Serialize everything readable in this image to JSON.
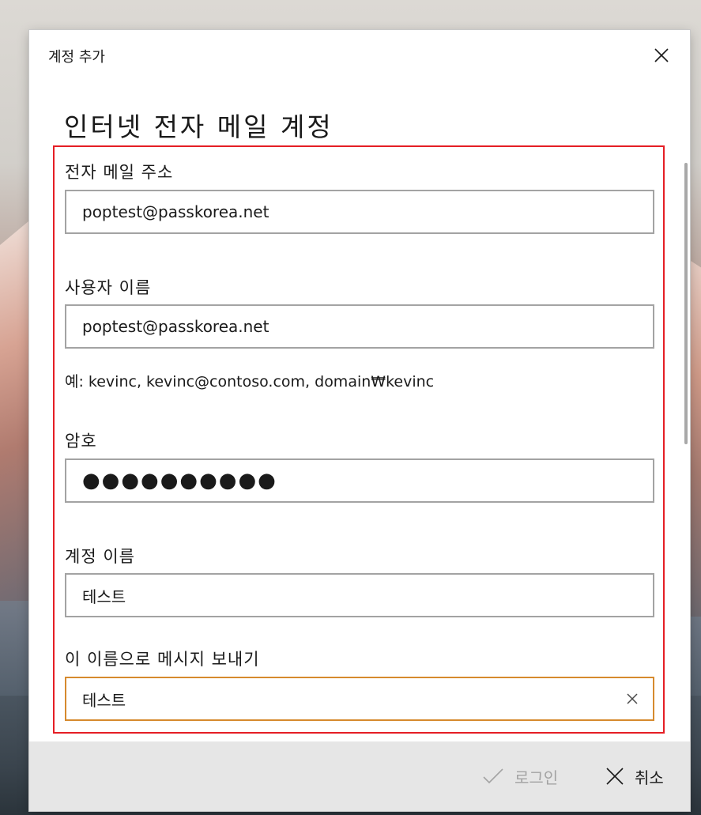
{
  "dialog": {
    "title": "계정 추가",
    "heading": "인터넷 전자 메일 계정"
  },
  "form": {
    "email": {
      "label": "전자 메일 주소",
      "value": "poptest@passkorea.net"
    },
    "username": {
      "label": "사용자 이름",
      "value": "poptest@passkorea.net",
      "hint": "예: kevinc, kevinc@contoso.com, domain₩kevinc"
    },
    "password": {
      "label": "암호",
      "value": "●●●●●●●●●●"
    },
    "account_name": {
      "label": "계정 이름",
      "value": "테스트"
    },
    "send_name": {
      "label": "이 이름으로 메시지 보내기",
      "value": "테스트"
    }
  },
  "footer": {
    "signin_label": "로그인",
    "cancel_label": "취소"
  },
  "icons": {
    "close": "close-icon",
    "clear": "clear-icon",
    "checkmark": "checkmark-icon",
    "cancel": "cancel-x-icon"
  },
  "colors": {
    "highlight_border": "#e51e25",
    "focus_border": "#d68a2e",
    "disabled_text": "#a3a3a3"
  }
}
